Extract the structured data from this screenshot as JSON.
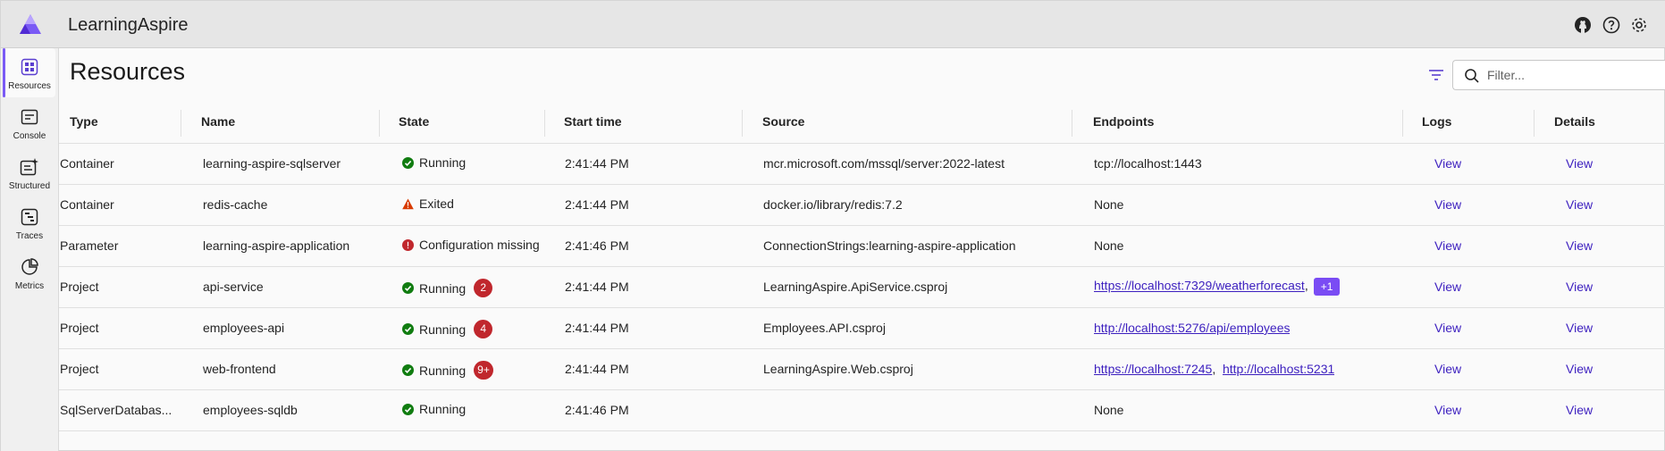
{
  "app": {
    "title": "LearningAspire"
  },
  "header_icons": [
    "github-icon",
    "help-icon",
    "settings-icon"
  ],
  "sidebar": {
    "items": [
      {
        "label": "Resources",
        "icon": "resources-icon",
        "active": true
      },
      {
        "label": "Console",
        "icon": "console-icon",
        "active": false
      },
      {
        "label": "Structured",
        "icon": "structured-logs-icon",
        "active": false
      },
      {
        "label": "Traces",
        "icon": "traces-icon",
        "active": false
      },
      {
        "label": "Metrics",
        "icon": "metrics-icon",
        "active": false
      }
    ]
  },
  "page": {
    "title": "Resources"
  },
  "search": {
    "placeholder": "Filter...",
    "value": ""
  },
  "colors": {
    "accent": "#7a5af5",
    "link": "#3c1fbf",
    "running": "#107c10",
    "exited": "#d83b01",
    "error": "#c0272d",
    "badge": "#c0272d"
  },
  "table": {
    "columns": [
      "Type",
      "Name",
      "State",
      "Start time",
      "Source",
      "Endpoints",
      "Logs",
      "Details"
    ],
    "rows": [
      {
        "type": "Container",
        "name": "learning-aspire-sqlserver",
        "state": "Running",
        "state_kind": "running",
        "badge": "",
        "start_time": "2:41:44 PM",
        "source": "mcr.microsoft.com/mssql/server:2022-latest",
        "endpoint_text": "tcp://localhost:1443",
        "endpoint_links": [],
        "extra_endpoints": "",
        "logs": "View",
        "details": "View"
      },
      {
        "type": "Container",
        "name": "redis-cache",
        "state": "Exited",
        "state_kind": "exited",
        "badge": "",
        "start_time": "2:41:44 PM",
        "source": "docker.io/library/redis:7.2",
        "endpoint_text": "None",
        "endpoint_links": [],
        "extra_endpoints": "",
        "logs": "View",
        "details": "View"
      },
      {
        "type": "Parameter",
        "name": "learning-aspire-application",
        "state": "Configuration missing",
        "state_kind": "error",
        "badge": "",
        "start_time": "2:41:46 PM",
        "source": "ConnectionStrings:learning-aspire-application",
        "endpoint_text": "None",
        "endpoint_links": [],
        "extra_endpoints": "",
        "logs": "View",
        "details": "View"
      },
      {
        "type": "Project",
        "name": "api-service",
        "state": "Running",
        "state_kind": "running",
        "badge": "2",
        "start_time": "2:41:44 PM",
        "source": "LearningAspire.ApiService.csproj",
        "endpoint_text": "",
        "endpoint_links": [
          "https://localhost:7329/weatherforecast"
        ],
        "extra_endpoints": "+1",
        "logs": "View",
        "details": "View"
      },
      {
        "type": "Project",
        "name": "employees-api",
        "state": "Running",
        "state_kind": "running",
        "badge": "4",
        "start_time": "2:41:44 PM",
        "source": "Employees.API.csproj",
        "endpoint_text": "",
        "endpoint_links": [
          "http://localhost:5276/api/employees"
        ],
        "extra_endpoints": "",
        "logs": "View",
        "details": "View"
      },
      {
        "type": "Project",
        "name": "web-frontend",
        "state": "Running",
        "state_kind": "running",
        "badge": "9+",
        "start_time": "2:41:44 PM",
        "source": "LearningAspire.Web.csproj",
        "endpoint_text": "",
        "endpoint_links": [
          "https://localhost:7245",
          "http://localhost:5231"
        ],
        "extra_endpoints": "",
        "logs": "View",
        "details": "View"
      },
      {
        "type": "SqlServerDatabas...",
        "name": "employees-sqldb",
        "state": "Running",
        "state_kind": "running",
        "badge": "",
        "start_time": "2:41:46 PM",
        "source": "",
        "endpoint_text": "None",
        "endpoint_links": [],
        "extra_endpoints": "",
        "logs": "View",
        "details": "View"
      }
    ]
  }
}
